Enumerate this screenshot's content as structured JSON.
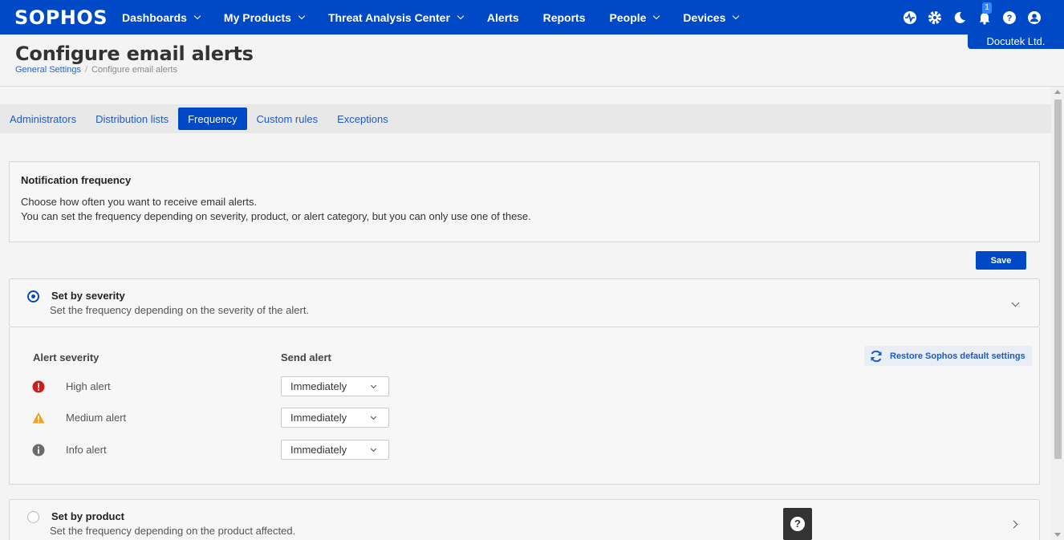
{
  "nav": {
    "logo": "SOPHOS",
    "items": [
      {
        "label": "Dashboards",
        "has_dropdown": true
      },
      {
        "label": "My Products",
        "has_dropdown": true
      },
      {
        "label": "Threat Analysis Center",
        "has_dropdown": true
      },
      {
        "label": "Alerts",
        "has_dropdown": false
      },
      {
        "label": "Reports",
        "has_dropdown": false
      },
      {
        "label": "People",
        "has_dropdown": true
      },
      {
        "label": "Devices",
        "has_dropdown": true
      }
    ],
    "icons": [
      "health-icon",
      "gear-icon",
      "moon-icon",
      "bell-icon",
      "help-icon",
      "user-icon"
    ],
    "notification_count": "1",
    "tenant": "Docutek Ltd.",
    "color": "#0049c6"
  },
  "header": {
    "title": "Configure email alerts",
    "breadcrumb": {
      "link": "General Settings",
      "current": "Configure email alerts"
    }
  },
  "tabs": [
    {
      "label": "Administrators",
      "active": false
    },
    {
      "label": "Distribution lists",
      "active": false
    },
    {
      "label": "Frequency",
      "active": true
    },
    {
      "label": "Custom rules",
      "active": false
    },
    {
      "label": "Exceptions",
      "active": false
    }
  ],
  "info": {
    "title": "Notification frequency",
    "line1": "Choose how often you want to receive email alerts.",
    "line2": "You can set the frequency depending on severity, product, or alert category, but you can only use one of these."
  },
  "save_label": "Save",
  "severity_option": {
    "title": "Set by severity",
    "description": "Set the frequency depending on the severity of the alert.",
    "selected": true
  },
  "severity_panel": {
    "col_severity": "Alert severity",
    "col_send": "Send alert",
    "restore_label": "Restore Sophos default settings",
    "rows": [
      {
        "label": "High alert",
        "icon": "error-icon",
        "value": "Immediately"
      },
      {
        "label": "Medium alert",
        "icon": "warning-icon",
        "value": "Immediately"
      },
      {
        "label": "Info alert",
        "icon": "info-icon",
        "value": "Immediately"
      }
    ]
  },
  "product_option": {
    "title": "Set by product",
    "description": "Set the frequency depending on the product affected.",
    "selected": false
  }
}
